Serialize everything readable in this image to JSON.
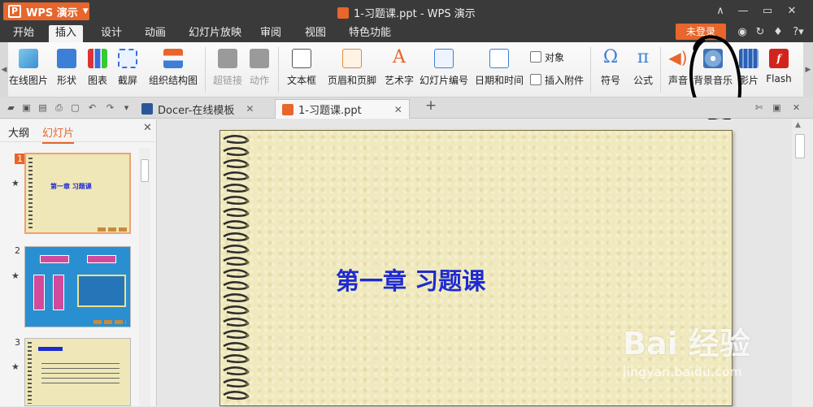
{
  "app": {
    "name": "WPS 演示",
    "window_title": "1-习题课.ppt - WPS 演示"
  },
  "menu": {
    "tabs": [
      "开始",
      "插入",
      "设计",
      "动画",
      "幻灯片放映",
      "审阅",
      "视图",
      "特色功能"
    ],
    "active_tab": "插入",
    "login_label": "未登录"
  },
  "ribbon": {
    "online_picture": "在线图片",
    "shapes": "形状",
    "chart": "图表",
    "screenshot": "截屏",
    "org_chart": "组织结构图",
    "hyperlink": "超链接",
    "action": "动作",
    "textbox": "文本框",
    "header_footer": "页眉和页脚",
    "wordart": "艺术字",
    "slide_number": "幻灯片编号",
    "date_time": "日期和时间",
    "object": "对象",
    "attachment": "插入附件",
    "symbol": "符号",
    "formula": "公式",
    "sound": "声音",
    "bg_music": "背景音乐",
    "movie": "影片",
    "flash": "Flash"
  },
  "tabstrip": {
    "tabs": [
      {
        "label": "Docer-在线模板",
        "active": false
      },
      {
        "label": "1-习题课.ppt",
        "active": true
      }
    ],
    "new_tab": "+"
  },
  "left_panel": {
    "tabs": [
      "大纲",
      "幻灯片"
    ],
    "active_tab": "幻灯片",
    "slides": [
      {
        "number": "1",
        "selected": true
      },
      {
        "number": "2",
        "selected": false
      },
      {
        "number": "3",
        "selected": false
      }
    ]
  },
  "slide": {
    "title": "第一章 习题课"
  },
  "watermark": {
    "brand": "Bai 经验",
    "url": "jingyan.baidu.com"
  },
  "colors": {
    "accent": "#e8652b",
    "title_blue": "#1d2bd1",
    "paper": "#f0e9bd"
  }
}
